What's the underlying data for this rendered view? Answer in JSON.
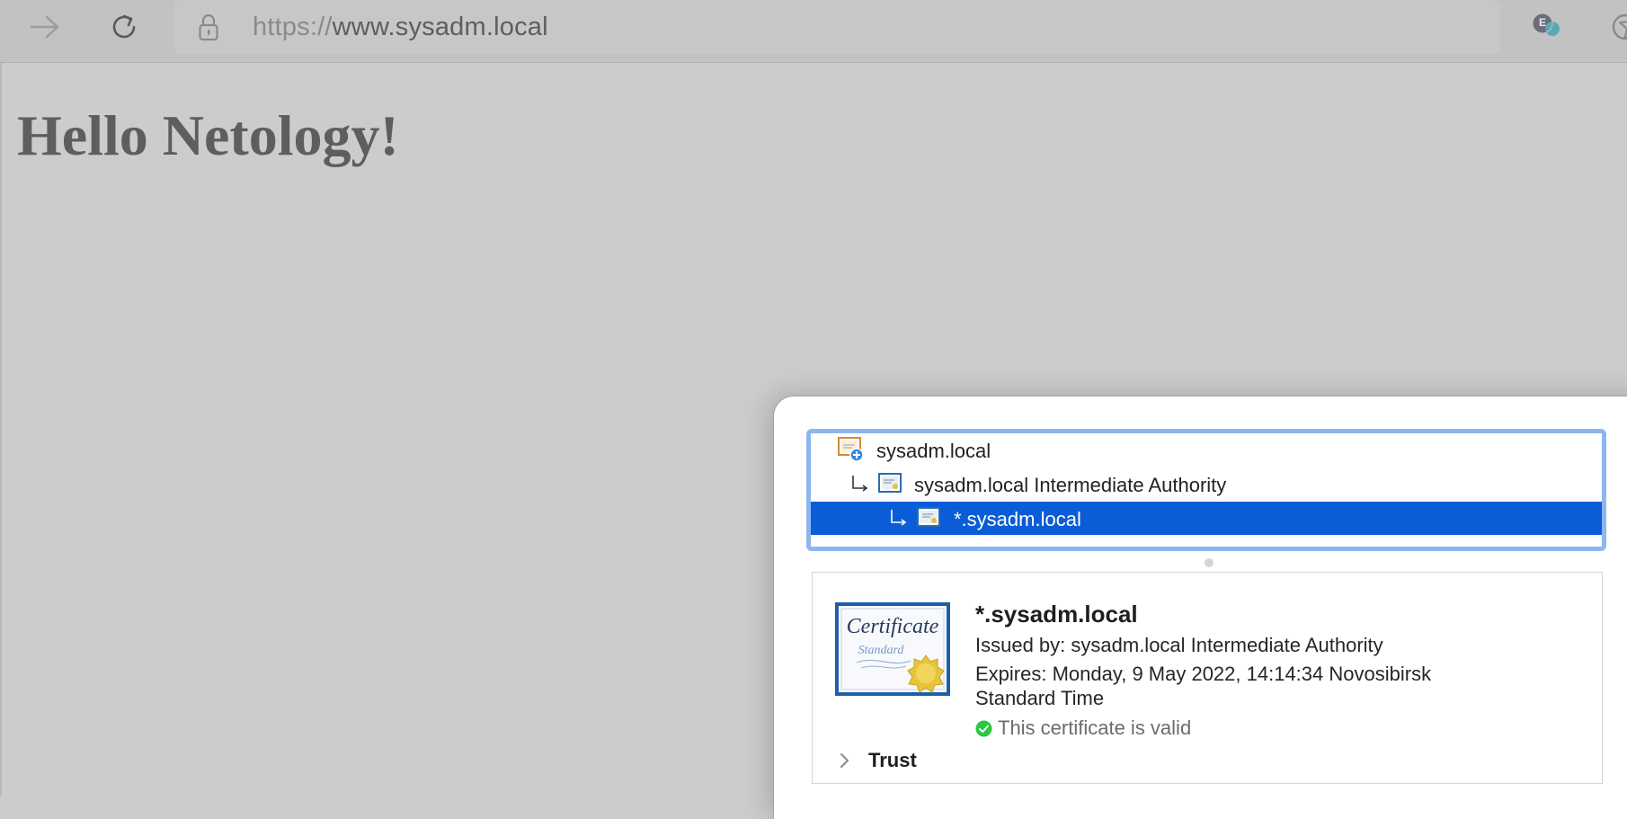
{
  "browser": {
    "url_scheme": "https://",
    "url_host": "www.sysadm.local",
    "profile_initial": "E"
  },
  "page": {
    "heading": "Hello Netology!"
  },
  "certificate_chain": {
    "items": [
      {
        "label": "sysadm.local",
        "icon": "root-certificate-icon"
      },
      {
        "label": "sysadm.local Intermediate Authority",
        "icon": "certificate-icon"
      },
      {
        "label": "*.sysadm.local",
        "icon": "certificate-icon",
        "selected": true
      }
    ]
  },
  "certificate_details": {
    "title": "*.sysadm.local",
    "issued_by": "Issued by: sysadm.local Intermediate Authority",
    "expires_line1": "Expires: Monday, 9 May 2022, 14:14:34 Novosibirsk",
    "expires_line2": "Standard Time",
    "status": "This certificate is valid",
    "trust_label": "Trust",
    "image_text_top": "Certificate",
    "image_text_bottom": "Standard"
  },
  "colors": {
    "selection": "#0a5dd6",
    "focus_ring": "#8db6f0",
    "valid_green": "#28c840"
  }
}
